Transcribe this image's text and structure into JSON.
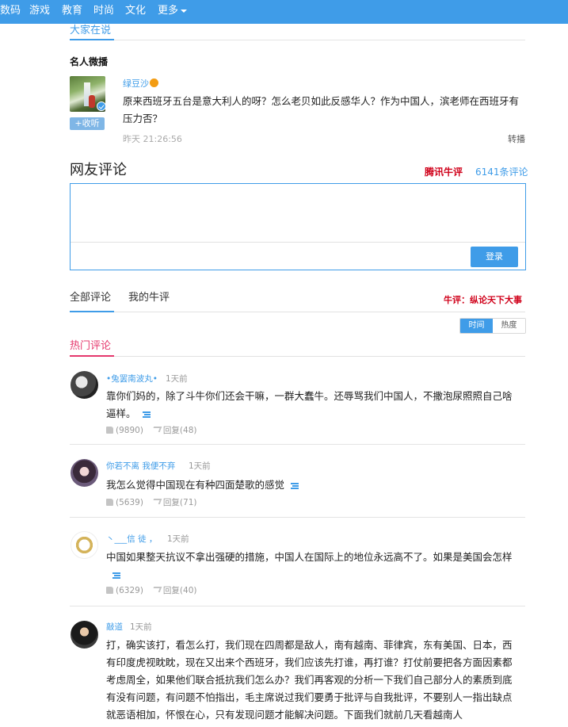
{
  "topnav": {
    "items": [
      "数码",
      "游戏",
      "教育",
      "时尚",
      "文化",
      "更多"
    ]
  },
  "section": {
    "title": "大家在说",
    "weibo_title": "名人微播"
  },
  "weibo": {
    "name": "绿豆沙",
    "follow_label": "+收听",
    "text": "原来西班牙五台是意大利人的呀？怎么老贝如此反感华人？作为中国人，滨老师在西班牙有压力否？",
    "time": "昨天  21:26:56",
    "repost_label": "转播"
  },
  "comments_header": {
    "title": "网友评论",
    "brand": "腾讯牛评",
    "count": "6141条评论",
    "login_label": "登录"
  },
  "tabs": {
    "all": "全部评论",
    "mine": "我的牛评",
    "slogan": "牛评：纵论天下大事",
    "sort_time": "时间",
    "sort_hot": "热度"
  },
  "hot": {
    "title": "热门评论"
  },
  "comments": [
    {
      "name": "•兔罢南波丸•",
      "time": "1天前",
      "text": "靠你们妈的，除了斗牛你们还会干嘛，一群大蠢牛。还辱骂我们中国人，不撒泡尿照照自己啥逼样。",
      "likes": "(9890)",
      "reply": "回复(48)"
    },
    {
      "name": "你若不离  我便不弃",
      "time": "1天前",
      "text": "我怎么觉得中国现在有种四面楚歌的感觉",
      "likes": "(5639)",
      "reply": "回复(71)"
    },
    {
      "name": "丶___信  徒 ，",
      "time": "1天前",
      "text": "中国如果整天抗议不拿出强硬的措施，中国人在国际上的地位永远高不了。如果是美国会怎样",
      "likes": "(6329)",
      "reply": "回复(40)"
    },
    {
      "name": "敲道",
      "time": "1天前",
      "text": "打，确实该打，看怎么打，我们现在四周都是敌人，南有越南、菲律宾，东有美国、日本，西有印度虎视眈眈，现在又出来个西班牙，我们应该先打谁，再打谁？打仗前要把各方面因素都考虑周全，如果他们联合抵抗我们怎么办？我们再客观的分析一下我们自己部分人的素质到底有没有问题，有问题不怕指出，毛主席说过我们要勇于批评与自我批评，不要别人一指出缺点就恶语相加，怀恨在心，只有发现问题才能解决问题。下面我们就前几天看越南人"
    }
  ],
  "colors": {
    "accent": "#3f9ce8",
    "brand_red": "#d0021b",
    "hot_pink": "#e5386d"
  }
}
